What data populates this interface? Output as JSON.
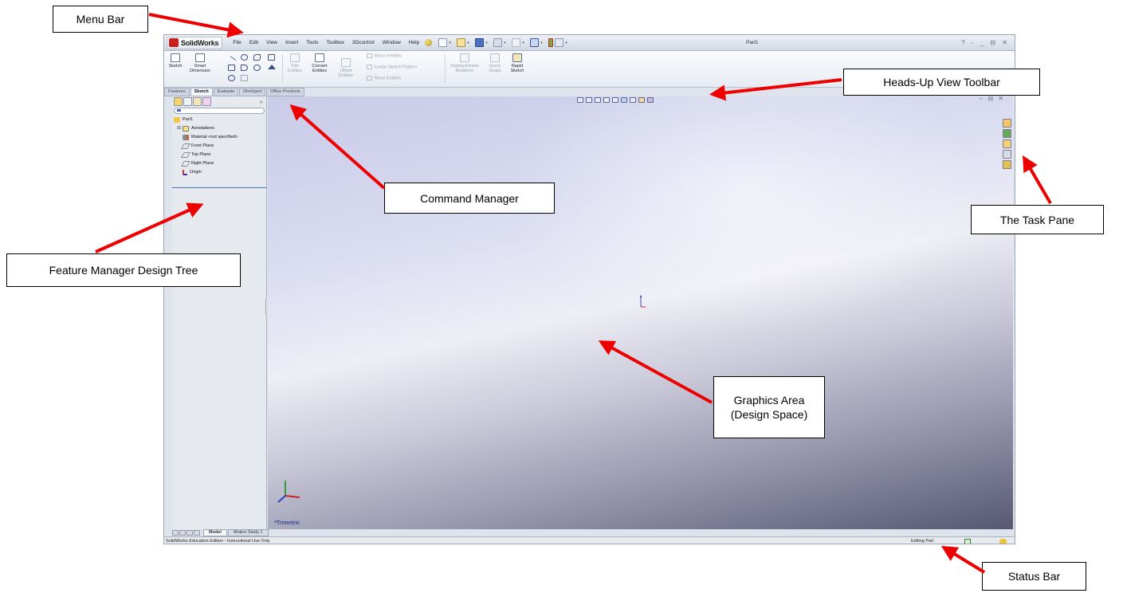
{
  "app": {
    "brand": "SolidWorks",
    "document_title": "Part1",
    "menu": [
      "File",
      "Edit",
      "View",
      "Insert",
      "Tools",
      "Toolbox",
      "3Dcontrol",
      "Window",
      "Help"
    ],
    "window_controls": "? - _ ⊟ ✕"
  },
  "command_manager": {
    "sketch": "Sketch",
    "smart_dimension_1": "Smart",
    "smart_dimension_2": "Dimension",
    "trim_1": "Trim",
    "trim_2": "Entities",
    "convert_1": "Convert",
    "convert_2": "Entities",
    "offset_1": "Offset",
    "offset_2": "Entities",
    "mirror": "Mirror Entities",
    "linear_pattern": "Linear Sketch Pattern",
    "move": "Move Entities",
    "display_delete_1": "Display/Delete",
    "display_delete_2": "Relations",
    "quick_snaps_1": "Quick",
    "quick_snaps_2": "Snaps",
    "rapid_1": "Rapid",
    "rapid_2": "Sketch"
  },
  "tabs": [
    {
      "label": "Features"
    },
    {
      "label": "Sketch"
    },
    {
      "label": "Evaluate"
    },
    {
      "label": "DimXpert"
    },
    {
      "label": "Office Products"
    }
  ],
  "feature_tree": {
    "root": "Part1",
    "items": [
      {
        "label": "Annotations",
        "icon": "annotations-icon"
      },
      {
        "label": "Material <not specified>",
        "icon": "material-icon"
      },
      {
        "label": "Front Plane",
        "icon": "plane-icon"
      },
      {
        "label": "Top Plane",
        "icon": "plane-icon"
      },
      {
        "label": "Right Plane",
        "icon": "plane-icon"
      },
      {
        "label": "Origin",
        "icon": "origin-icon"
      }
    ],
    "expand": "»"
  },
  "graphics": {
    "view_name": "*Trimetric",
    "controls": "– ⊟ ✕"
  },
  "bottom_tabs": [
    "Model",
    "Motion Study 1"
  ],
  "status_bar": {
    "left_text": "SolidWorks Education Edition - Instructional Use Only",
    "mode": "Editing Part"
  },
  "callouts": {
    "menu_bar": "Menu Bar",
    "heads_up": "Heads-Up View Toolbar",
    "command_manager": "Command Manager",
    "task_pane": "The Task Pane",
    "feature_manager": "Feature Manager Design Tree",
    "graphics_area_1": "Graphics Area",
    "graphics_area_2": "(Design Space)",
    "status_bar": "Status Bar"
  },
  "colors": {
    "annotation_arrow": "#ee0000",
    "brand_red": "#c8201f",
    "selection_blue": "#4a72b8"
  }
}
